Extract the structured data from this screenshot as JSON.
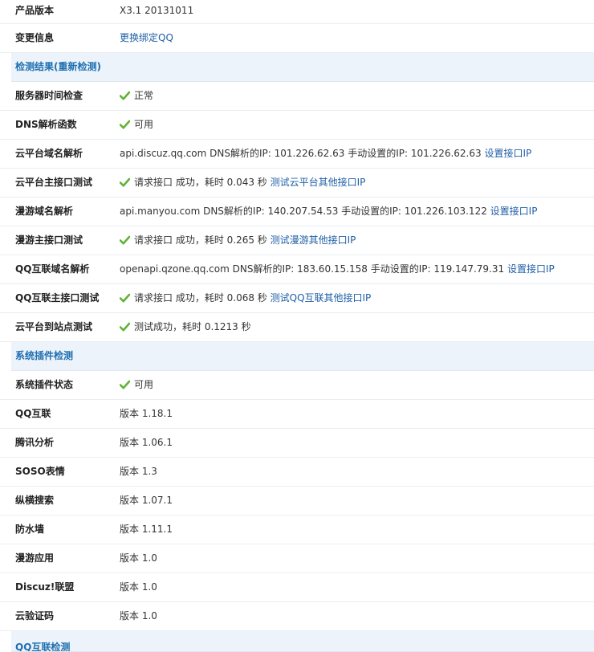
{
  "rows_top": [
    {
      "label": "产品版本",
      "value": "X3.1 20131011"
    },
    {
      "label": "变更信息",
      "link": "更换绑定QQ"
    }
  ],
  "section_check": {
    "title": "检测结果(重新检测)",
    "rows": [
      {
        "label": "服务器时间检查",
        "status": "正常"
      },
      {
        "label": "DNS解析函数",
        "status": "可用"
      },
      {
        "label": "云平台域名解析",
        "text": "api.discuz.qq.com DNS解析的IP: 101.226.62.63 手动设置的IP: 101.226.62.63 ",
        "link": "设置接口IP"
      },
      {
        "label": "云平台主接口测试",
        "status": "请求接口 成功，耗时 0.043 秒 ",
        "link": "测试云平台其他接口IP"
      },
      {
        "label": "漫游域名解析",
        "text": "api.manyou.com DNS解析的IP: 140.207.54.53 手动设置的IP: 101.226.103.122 ",
        "link": "设置接口IP"
      },
      {
        "label": "漫游主接口测试",
        "status": "请求接口 成功，耗时 0.265 秒 ",
        "link": "测试漫游其他接口IP"
      },
      {
        "label": "QQ互联域名解析",
        "text": "openapi.qzone.qq.com DNS解析的IP: 183.60.15.158 手动设置的IP: 119.147.79.31 ",
        "link": "设置接口IP"
      },
      {
        "label": "QQ互联主接口测试",
        "status": "请求接口 成功，耗时 0.068 秒 ",
        "link": "测试QQ互联其他接口IP"
      },
      {
        "label": "云平台到站点测试",
        "status": "测试成功，耗时 0.1213 秒"
      }
    ]
  },
  "section_plugins": {
    "title": "系统插件检测",
    "rows": [
      {
        "label": "系统插件状态",
        "status": "可用"
      },
      {
        "label": "QQ互联",
        "text": "版本 1.18.1"
      },
      {
        "label": "腾讯分析",
        "text": "版本 1.06.1"
      },
      {
        "label": "SOSO表情",
        "text": "版本 1.3"
      },
      {
        "label": "纵横搜索",
        "text": "版本 1.07.1"
      },
      {
        "label": "防水墙",
        "text": "版本 1.11.1"
      },
      {
        "label": "漫游应用",
        "text": "版本 1.0"
      },
      {
        "label": "Discuz!联盟",
        "text": "版本 1.0"
      },
      {
        "label": "云验证码",
        "text": "版本 1.0"
      }
    ]
  },
  "section_qq": {
    "title": "QQ互联检测"
  },
  "colors": {
    "link": "#1f5fa6",
    "section_bg": "#edf3fa",
    "check": "#5fb336"
  },
  "icons": {
    "status_ok": "check-icon"
  }
}
